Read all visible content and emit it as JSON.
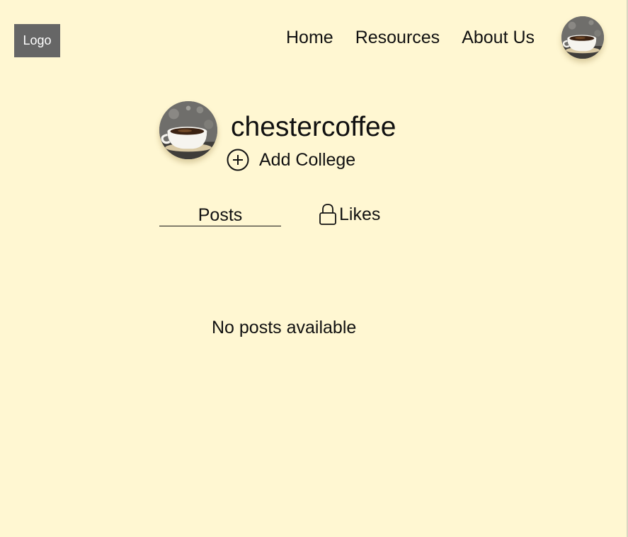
{
  "header": {
    "logo_label": "Logo",
    "nav": [
      {
        "label": "Home"
      },
      {
        "label": "Resources"
      },
      {
        "label": "About Us"
      }
    ],
    "avatar_icon": "coffee-cup-avatar"
  },
  "profile": {
    "username": "chestercoffee",
    "avatar_icon": "coffee-cup-avatar",
    "add_college_icon": "plus-circle-icon",
    "add_college_label": "Add College"
  },
  "tabs": [
    {
      "label": "Posts",
      "active": true
    },
    {
      "label": "Likes",
      "icon": "lock-icon",
      "active": false
    }
  ],
  "content": {
    "empty_message": "No posts available"
  },
  "colors": {
    "background": "#fff7d2",
    "logo_background": "#666666",
    "text": "#111111"
  }
}
